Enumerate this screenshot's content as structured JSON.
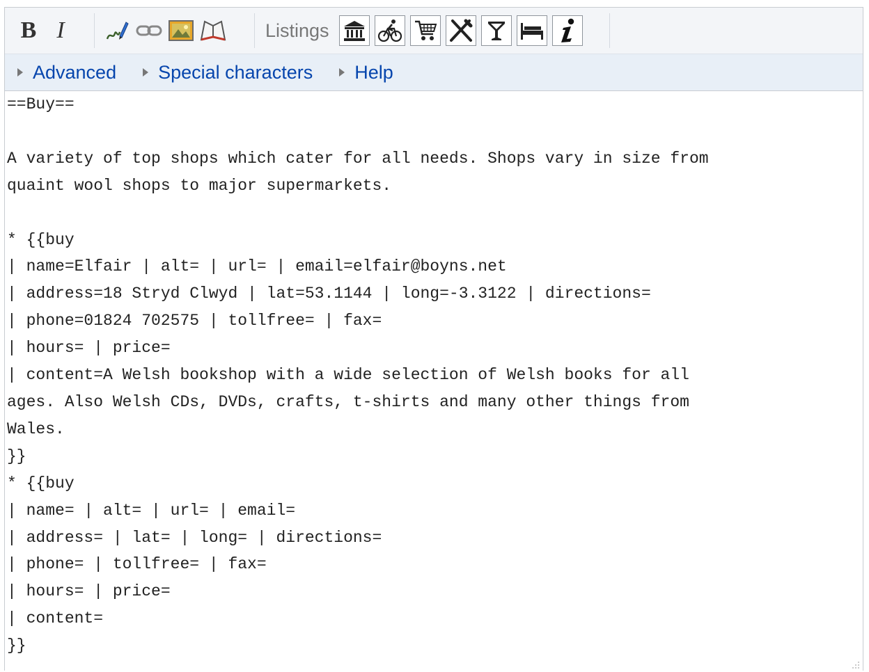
{
  "toolbar": {
    "format": {
      "bold_label": "B",
      "italic_label": "I"
    },
    "insert_icons": [
      "signature-icon",
      "link-icon",
      "image-icon",
      "reference-icon"
    ],
    "listings": {
      "label": "Listings",
      "icons": [
        "see-icon",
        "do-icon",
        "buy-icon",
        "eat-icon",
        "drink-icon",
        "sleep-icon",
        "other-icon"
      ]
    }
  },
  "advanced_bar": {
    "links": [
      {
        "label": "Advanced"
      },
      {
        "label": "Special characters"
      },
      {
        "label": "Help"
      }
    ]
  },
  "editor": {
    "content": "==Buy==\n\nA variety of top shops which cater for all needs. Shops vary in size from\nquaint wool shops to major supermarkets.\n\n* {{buy\n| name=Elfair | alt= | url= | email=elfair@boyns.net\n| address=18 Stryd Clwyd | lat=53.1144 | long=-3.3122 | directions=\n| phone=01824 702575 | tollfree= | fax=\n| hours= | price=\n| content=A Welsh bookshop with a wide selection of Welsh books for all\nages. Also Welsh CDs, DVDs, crafts, t-shirts and many other things from\nWales.\n}}\n* {{buy\n| name= | alt= | url= | email=\n| address= | lat= | long= | directions=\n| phone= | tollfree= | fax=\n| hours= | price=\n| content=\n}}"
  },
  "colors": {
    "toolbar_bg": "#f3f5f8",
    "advanced_bg": "#e8eff7",
    "link": "#0645ad"
  }
}
